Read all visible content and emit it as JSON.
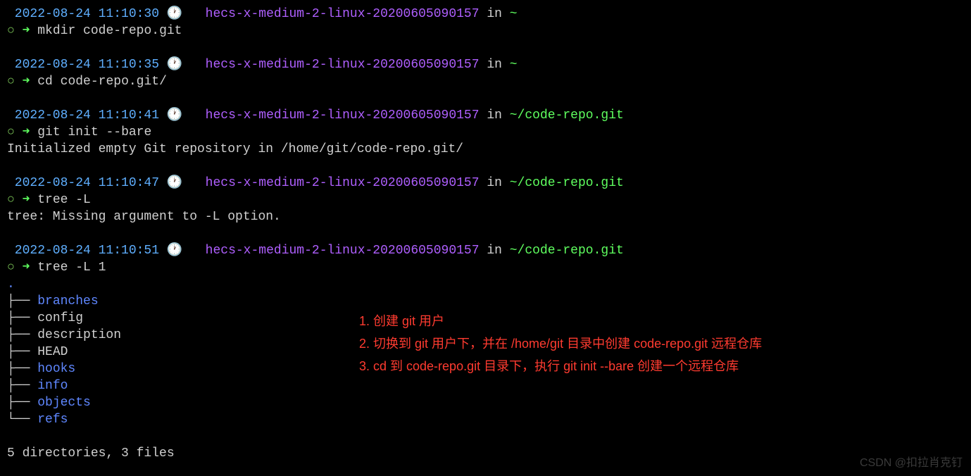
{
  "blocks": [
    {
      "timestamp": "2022-08-24 11:10:30",
      "hostname": "hecs-x-medium-2-linux-20200605090157",
      "in": "in",
      "path": "~",
      "command": "mkdir code-repo.git",
      "outputs": []
    },
    {
      "timestamp": "2022-08-24 11:10:35",
      "hostname": "hecs-x-medium-2-linux-20200605090157",
      "in": "in",
      "path": "~",
      "command": "cd code-repo.git/",
      "outputs": []
    },
    {
      "timestamp": "2022-08-24 11:10:41",
      "hostname": "hecs-x-medium-2-linux-20200605090157",
      "in": "in",
      "path": "~/code-repo.git",
      "command": "git init --bare",
      "outputs": [
        "Initialized empty Git repository in /home/git/code-repo.git/"
      ]
    },
    {
      "timestamp": "2022-08-24 11:10:47",
      "hostname": "hecs-x-medium-2-linux-20200605090157",
      "in": "in",
      "path": "~/code-repo.git",
      "command": "tree -L",
      "outputs": [
        "tree: Missing argument to -L option."
      ]
    },
    {
      "timestamp": "2022-08-24 11:10:51",
      "hostname": "hecs-x-medium-2-linux-20200605090157",
      "in": "in",
      "path": "~/code-repo.git",
      "command": "tree -L 1",
      "outputs": []
    }
  ],
  "tree": {
    "root": ".",
    "items": [
      {
        "name": "branches",
        "type": "dir",
        "last": false
      },
      {
        "name": "config",
        "type": "file",
        "last": false
      },
      {
        "name": "description",
        "type": "file",
        "last": false
      },
      {
        "name": "HEAD",
        "type": "file",
        "last": false
      },
      {
        "name": "hooks",
        "type": "dir",
        "last": false
      },
      {
        "name": "info",
        "type": "dir",
        "last": false
      },
      {
        "name": "objects",
        "type": "dir",
        "last": false
      },
      {
        "name": "refs",
        "type": "dir",
        "last": true
      }
    ],
    "summary": "5 directories, 3 files"
  },
  "annotations": [
    "1. 创建 git 用户",
    "2. 切换到 git 用户下，并在 /home/git 目录中创建 code-repo.git 远程仓库",
    "3. cd 到 code-repo.git 目录下，执行 git init --bare 创建一个远程仓库"
  ],
  "watermark": "CSDN @扣拉肖克钉",
  "symbols": {
    "clock": "🕐",
    "marker": "○",
    "arrow": "➜",
    "tree_mid": "├──",
    "tree_last": "└──"
  }
}
